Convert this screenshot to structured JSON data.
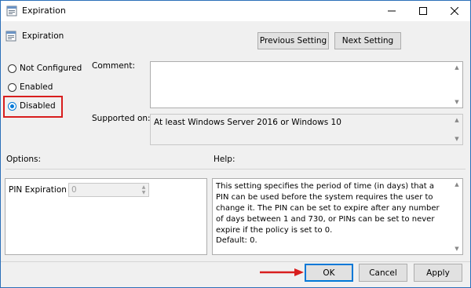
{
  "window": {
    "title": "Expiration",
    "minimize_icon": "minimize-icon",
    "maximize_icon": "maximize-icon",
    "close_icon": "close-icon"
  },
  "header": {
    "policy_name": "Expiration",
    "previous_label": "Previous Setting",
    "next_label": "Next Setting"
  },
  "state": {
    "options": [
      {
        "label": "Not Configured",
        "selected": false
      },
      {
        "label": "Enabled",
        "selected": false
      },
      {
        "label": "Disabled",
        "selected": true
      }
    ]
  },
  "comment": {
    "label": "Comment:",
    "value": ""
  },
  "supported": {
    "label": "Supported on:",
    "value": "At least Windows Server 2016 or Windows 10"
  },
  "options_panel": {
    "label": "Options:",
    "pin_label": "PIN Expiration",
    "pin_value": "0"
  },
  "help_panel": {
    "label": "Help:",
    "text_1": "This setting specifies the period of time (in days) that a PIN can be used before the system requires the user to change it. The PIN can be set to expire after any number of days between 1 and 730, or PINs can be set to never expire if the policy is set to 0.",
    "text_2": "Default: 0."
  },
  "footer": {
    "ok_label": "OK",
    "cancel_label": "Cancel",
    "apply_label": "Apply"
  },
  "colors": {
    "accent": "#0078d7",
    "highlight": "#d81e1e"
  }
}
